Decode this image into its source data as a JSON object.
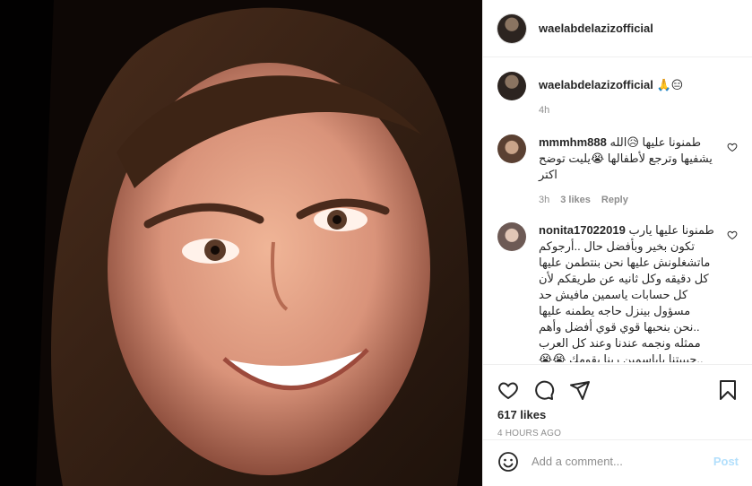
{
  "post": {
    "username": "waelabdelazizofficial",
    "caption_username": "waelabdelazizofficial",
    "caption_text": "🙏😑",
    "caption_time": "4h",
    "likes": "617 likes",
    "posted_ago": "4 HOURS AGO"
  },
  "comments": [
    {
      "username": "mmmhm888",
      "text": "طمنونا عليها 😥الله يشفيها وترجع لأطفالها 😭يليت توضح اكتر",
      "time": "3h",
      "likes": "3 likes",
      "reply": "Reply"
    },
    {
      "username": "nonita17022019",
      "text": "طمنونا عليها يارب تكون بخير وبأفضل حال ..أرجوكم ماتشغلونش عليها نحن بنتطمن عليها كل دقيقه وكل ثانيه عن طريقكم لأن كل حسابات ياسمين مافيش حد مسؤول بينزل حاجه يطمنه عليها ..نحن بنحبها قوي قوي أفضل وأهم ممثله ونجمه عندنا وعند كل العرب ..حبيبتنا ياياسمين ربنا يقومك 😭😭😭😭بالسلامه يااااااارب"
    }
  ],
  "add_comment": {
    "placeholder": "Add a comment...",
    "post_label": "Post"
  },
  "icons": {
    "like": "heart-icon",
    "comment": "comment-icon",
    "share": "share-icon",
    "save": "bookmark-icon",
    "emoji": "emoji-icon"
  }
}
